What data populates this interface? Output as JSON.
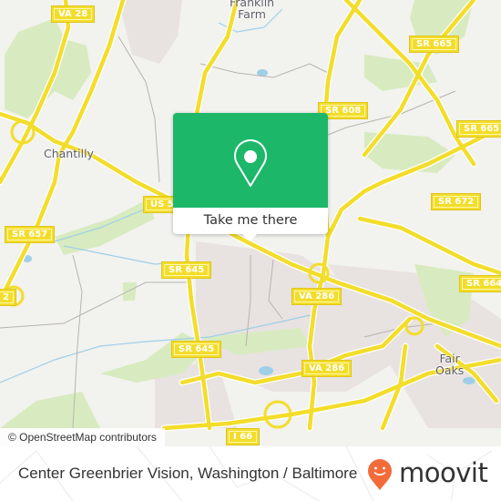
{
  "map": {
    "colors": {
      "background": "#f2f2ee",
      "road": "#f3dd2b",
      "road_outline": "#ffffff",
      "park": "#d8ebc0",
      "urban": "#e8e2e0",
      "water": "#9fcfe8",
      "minor_road": "#b8b4b0"
    },
    "place_labels": [
      {
        "id": "franklin-farm",
        "lines": [
          "Franklin",
          "Farm"
        ]
      },
      {
        "id": "chantilly",
        "lines": [
          "Chantilly"
        ]
      },
      {
        "id": "fair-oaks",
        "lines": [
          "Fair",
          "Oaks"
        ]
      }
    ],
    "road_shields": [
      {
        "id": "va-28",
        "label": "VA 28"
      },
      {
        "id": "sr-665-a",
        "label": "SR 665"
      },
      {
        "id": "sr-665-b",
        "label": "SR 665"
      },
      {
        "id": "sr-608",
        "label": "SR 608"
      },
      {
        "id": "us-50",
        "label": "US 5"
      },
      {
        "id": "sr-657",
        "label": "SR 657"
      },
      {
        "id": "sr-672",
        "label": "SR 672"
      },
      {
        "id": "sr-645-a",
        "label": "SR 645"
      },
      {
        "id": "sr-645-b",
        "label": "SR 645"
      },
      {
        "id": "va-286-a",
        "label": "VA 286"
      },
      {
        "id": "va-286-b",
        "label": "VA 286"
      },
      {
        "id": "sr-664",
        "label": "SR 664"
      },
      {
        "id": "edge-2",
        "label": "2"
      },
      {
        "id": "i-66",
        "label": "I 66"
      }
    ],
    "attribution": "© OpenStreetMap contributors"
  },
  "popup": {
    "accent": "#1db76a",
    "icon": "location-pin-icon",
    "button_label": "Take me there"
  },
  "footer": {
    "title": "Center Greenbrier Vision, Washington / Baltimore",
    "brand": "moovit",
    "brand_icon": "moovit-smiley-pin-icon",
    "brand_color": "#f26b3a"
  }
}
